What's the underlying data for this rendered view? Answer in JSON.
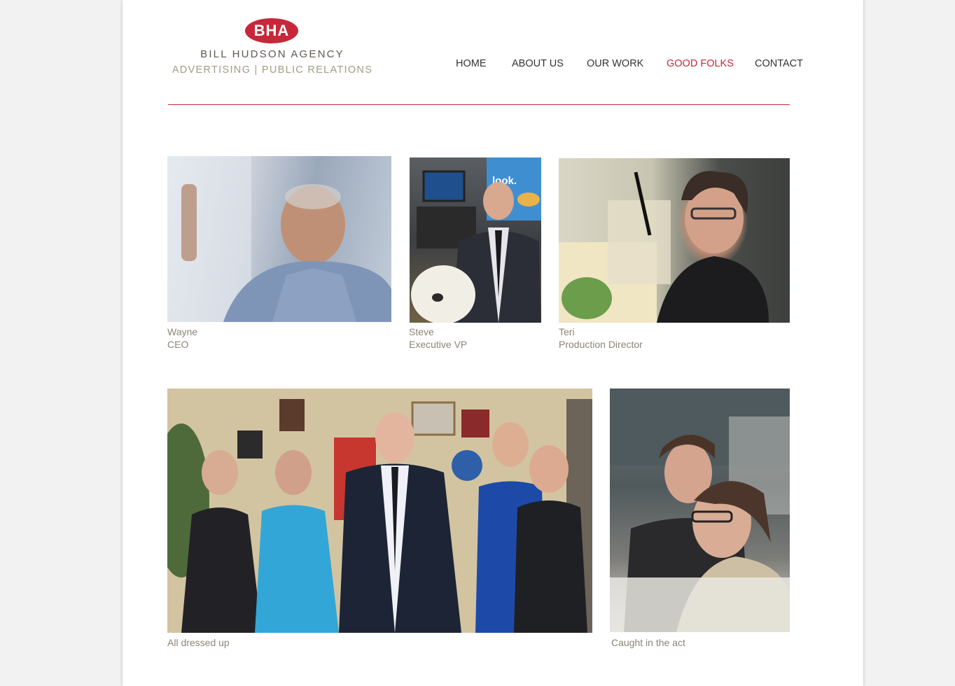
{
  "logo": {
    "mark": "BHA",
    "name": "BILL HUDSON AGENCY",
    "tagline": "ADVERTISING | PUBLIC RELATIONS",
    "colors": {
      "mark": "#c8273a",
      "name": "#5f5a50",
      "tagline": "#a39b80"
    }
  },
  "nav": {
    "items": [
      {
        "label": "HOME"
      },
      {
        "label": "ABOUT US"
      },
      {
        "label": "OUR WORK"
      },
      {
        "label": "GOOD FOLKS",
        "active": true
      },
      {
        "label": "CONTACT"
      }
    ],
    "accent_color": "#c8273a"
  },
  "people": [
    {
      "name": "Wayne",
      "title": "CEO"
    },
    {
      "name": "Steve",
      "title": "Executive VP"
    },
    {
      "name": "Teri",
      "title": "Production Director"
    }
  ],
  "gallery": [
    {
      "caption": "All dressed up"
    },
    {
      "caption": "Caught in the act"
    }
  ],
  "caption_color": "#8c8576"
}
